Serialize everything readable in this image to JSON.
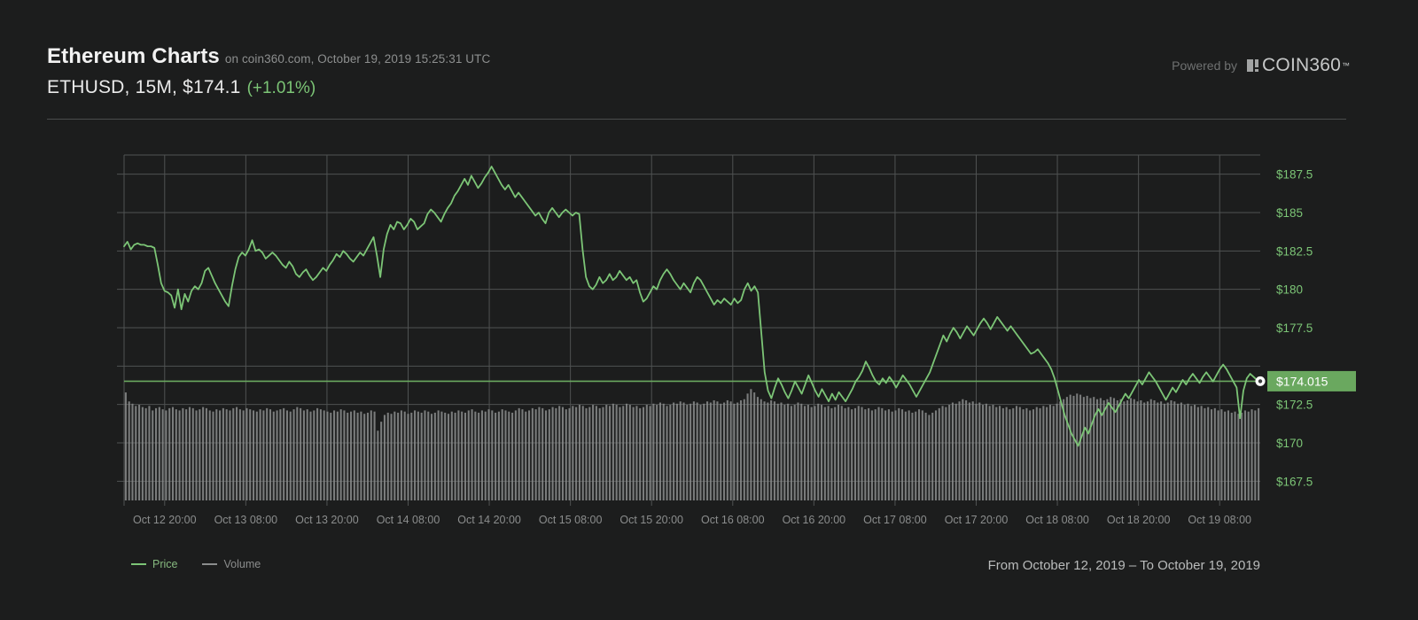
{
  "header": {
    "title": "Ethereum Charts",
    "subtitle": "on coin360.com, October 19, 2019 15:25:31 UTC",
    "pair_line": "ETHUSD, 15M, $174.1",
    "pct_change": "(+1.01%)",
    "powered_by": "Powered by",
    "logo_text": "COIN360",
    "logo_tm": "™"
  },
  "legend": {
    "price_label": "Price",
    "volume_label": "Volume",
    "price_color": "#7cc576",
    "volume_color": "#8b8d8d"
  },
  "footer": {
    "range_text": "From October 12, 2019 – To October 19, 2019"
  },
  "current_price_badge": {
    "value": "$174.015",
    "background": "#6aa85f",
    "text_color": "#ffffff"
  },
  "chart_data": {
    "type": "line",
    "title": "ETHUSD, 15M",
    "xlabel": "",
    "ylabel": "",
    "grid": true,
    "legend_position": "bottom-left",
    "ylim": [
      166.25,
      188.75
    ],
    "yticks": [
      187.5,
      185,
      182.5,
      180,
      177.5,
      175,
      172.5,
      170,
      167.5
    ],
    "ytick_labels": [
      "$187.5",
      "$185",
      "$182.5",
      "$180",
      "$177.5",
      "",
      "$172.5",
      "$170",
      "$167.5"
    ],
    "xticks": [
      "Oct 12 20:00",
      "Oct 13 08:00",
      "Oct 13 20:00",
      "Oct 14 08:00",
      "Oct 14 20:00",
      "Oct 15 08:00",
      "Oct 15 20:00",
      "Oct 16 08:00",
      "Oct 16 20:00",
      "Oct 17 08:00",
      "Oct 17 20:00",
      "Oct 18 08:00",
      "Oct 18 20:00",
      "Oct 19 08:00"
    ],
    "current_price": 174.015,
    "price_reference_line": 174.015,
    "series": [
      {
        "name": "Price",
        "color": "#7cc576",
        "values": [
          182.8,
          183.1,
          182.6,
          182.9,
          183.0,
          182.9,
          182.9,
          182.8,
          182.8,
          182.7,
          181.6,
          180.4,
          179.9,
          179.8,
          179.6,
          178.8,
          180.0,
          178.7,
          179.7,
          179.2,
          179.9,
          180.2,
          180.0,
          180.4,
          181.2,
          181.4,
          180.9,
          180.4,
          180.0,
          179.6,
          179.2,
          178.9,
          180.2,
          181.3,
          182.1,
          182.4,
          182.2,
          182.6,
          183.2,
          182.5,
          182.6,
          182.4,
          182.0,
          182.2,
          182.4,
          182.2,
          181.9,
          181.6,
          181.4,
          181.8,
          181.5,
          181.0,
          180.8,
          181.1,
          181.3,
          180.9,
          180.6,
          180.8,
          181.1,
          181.4,
          181.2,
          181.6,
          181.9,
          182.3,
          182.1,
          182.5,
          182.3,
          182.0,
          181.8,
          182.1,
          182.4,
          182.2,
          182.6,
          183.0,
          183.4,
          182.2,
          180.8,
          182.6,
          183.6,
          184.2,
          183.9,
          184.4,
          184.3,
          183.9,
          184.2,
          184.6,
          184.4,
          183.9,
          184.1,
          184.3,
          184.9,
          185.2,
          185.0,
          184.7,
          184.4,
          184.9,
          185.3,
          185.6,
          186.1,
          186.4,
          186.8,
          187.2,
          186.8,
          187.4,
          187.0,
          186.6,
          186.9,
          187.3,
          187.6,
          188.0,
          187.6,
          187.2,
          186.8,
          186.5,
          186.8,
          186.4,
          186.0,
          186.3,
          186.0,
          185.7,
          185.4,
          185.1,
          184.8,
          185.0,
          184.6,
          184.3,
          185.0,
          185.3,
          185.0,
          184.7,
          185.0,
          185.2,
          185.0,
          184.8,
          185.0,
          184.9,
          182.6,
          180.8,
          180.2,
          180.0,
          180.3,
          180.8,
          180.4,
          180.6,
          181.0,
          180.6,
          180.8,
          181.2,
          180.9,
          180.6,
          180.8,
          180.4,
          180.6,
          179.8,
          179.2,
          179.4,
          179.8,
          180.2,
          180.0,
          180.6,
          181.0,
          181.3,
          181.0,
          180.6,
          180.3,
          180.0,
          180.4,
          180.1,
          179.8,
          180.4,
          180.8,
          180.6,
          180.2,
          179.8,
          179.4,
          179.0,
          179.3,
          179.1,
          179.4,
          179.2,
          179.0,
          179.4,
          179.1,
          179.3,
          180.0,
          180.4,
          179.9,
          180.2,
          179.8,
          177.2,
          174.6,
          173.4,
          172.9,
          173.6,
          174.2,
          173.8,
          173.3,
          172.9,
          173.4,
          174.0,
          173.6,
          173.2,
          173.8,
          174.4,
          173.9,
          173.4,
          173.0,
          173.5,
          173.1,
          172.7,
          173.2,
          172.8,
          173.3,
          173.0,
          172.7,
          173.1,
          173.5,
          174.0,
          174.3,
          174.7,
          175.3,
          174.9,
          174.4,
          174.0,
          173.8,
          174.2,
          173.9,
          174.3,
          174.0,
          173.6,
          174.0,
          174.4,
          174.1,
          173.8,
          173.4,
          173.0,
          173.4,
          173.8,
          174.2,
          174.6,
          175.2,
          175.8,
          176.4,
          177.0,
          176.6,
          177.1,
          177.5,
          177.2,
          176.8,
          177.2,
          177.6,
          177.3,
          177.0,
          177.4,
          177.8,
          178.1,
          177.8,
          177.4,
          177.8,
          178.2,
          177.9,
          177.6,
          177.3,
          177.6,
          177.3,
          177.0,
          176.7,
          176.4,
          176.1,
          175.8,
          175.9,
          176.1,
          175.8,
          175.5,
          175.2,
          174.8,
          174.2,
          173.4,
          172.6,
          171.8,
          171.2,
          170.6,
          170.2,
          169.8,
          170.4,
          171.0,
          170.6,
          171.2,
          171.8,
          172.2,
          171.8,
          172.2,
          172.6,
          172.3,
          172.0,
          172.4,
          172.8,
          173.2,
          172.9,
          173.3,
          173.7,
          174.1,
          173.8,
          174.2,
          174.6,
          174.3,
          174.0,
          173.6,
          173.2,
          172.8,
          173.2,
          173.6,
          173.3,
          173.7,
          174.1,
          173.8,
          174.2,
          174.5,
          174.2,
          173.9,
          174.3,
          174.6,
          174.3,
          174.0,
          174.4,
          174.8,
          175.1,
          174.8,
          174.4,
          174.0,
          173.6,
          171.6,
          173.4,
          174.2,
          174.5,
          174.3,
          174.1,
          174.015
        ]
      }
    ],
    "volume": {
      "name": "Volume",
      "color": "#8b8d8d",
      "values": [
        96,
        88,
        86,
        84,
        85,
        83,
        82,
        84,
        80,
        82,
        83,
        81,
        80,
        82,
        83,
        81,
        80,
        82,
        81,
        83,
        82,
        80,
        81,
        83,
        82,
        80,
        79,
        81,
        80,
        82,
        81,
        80,
        82,
        83,
        81,
        80,
        82,
        81,
        80,
        79,
        81,
        80,
        82,
        81,
        79,
        80,
        81,
        82,
        80,
        79,
        81,
        83,
        82,
        80,
        81,
        79,
        80,
        82,
        81,
        80,
        79,
        78,
        80,
        79,
        81,
        80,
        78,
        79,
        80,
        78,
        79,
        77,
        78,
        80,
        79,
        62,
        70,
        76,
        78,
        77,
        79,
        78,
        80,
        79,
        77,
        78,
        80,
        79,
        78,
        80,
        79,
        77,
        78,
        80,
        79,
        78,
        77,
        79,
        78,
        80,
        79,
        78,
        80,
        81,
        79,
        78,
        80,
        79,
        81,
        80,
        78,
        79,
        81,
        80,
        79,
        78,
        80,
        82,
        81,
        79,
        80,
        82,
        81,
        83,
        82,
        80,
        81,
        83,
        82,
        84,
        83,
        81,
        82,
        84,
        83,
        85,
        84,
        82,
        83,
        85,
        84,
        82,
        83,
        85,
        84,
        86,
        85,
        83,
        84,
        86,
        85,
        83,
        84,
        82,
        83,
        85,
        84,
        86,
        85,
        87,
        86,
        84,
        85,
        87,
        86,
        88,
        87,
        85,
        86,
        88,
        87,
        85,
        86,
        88,
        87,
        89,
        88,
        86,
        87,
        89,
        88,
        86,
        87,
        89,
        90,
        95,
        99,
        96,
        92,
        90,
        88,
        87,
        89,
        88,
        86,
        87,
        85,
        86,
        84,
        85,
        87,
        86,
        84,
        85,
        83,
        84,
        86,
        85,
        83,
        84,
        82,
        83,
        85,
        84,
        82,
        83,
        81,
        82,
        84,
        83,
        81,
        82,
        80,
        81,
        83,
        82,
        80,
        81,
        79,
        80,
        82,
        81,
        79,
        80,
        78,
        79,
        81,
        80,
        78,
        76,
        78,
        80,
        82,
        84,
        83,
        85,
        87,
        86,
        88,
        90,
        89,
        87,
        88,
        86,
        87,
        85,
        86,
        84,
        85,
        83,
        84,
        82,
        83,
        81,
        82,
        84,
        83,
        81,
        82,
        80,
        81,
        83,
        82,
        84,
        83,
        85,
        84,
        86,
        88,
        90,
        92,
        94,
        93,
        95,
        94,
        92,
        93,
        91,
        92,
        90,
        91,
        89,
        90,
        92,
        91,
        89,
        90,
        88,
        89,
        91,
        90,
        88,
        89,
        87,
        88,
        90,
        89,
        87,
        88,
        86,
        87,
        89,
        88,
        86,
        87,
        85,
        86,
        84,
        85,
        83,
        84,
        82,
        83,
        81,
        82,
        80,
        81,
        79,
        80,
        78,
        79,
        77,
        78,
        80,
        79,
        81,
        80,
        82
      ]
    }
  }
}
